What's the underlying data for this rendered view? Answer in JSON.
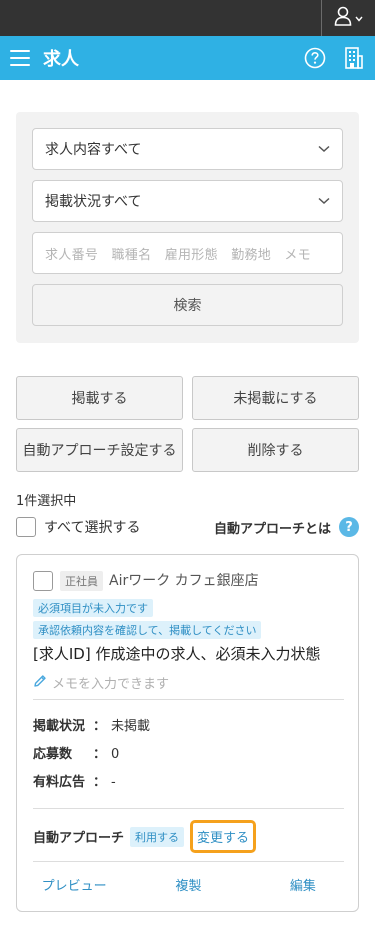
{
  "header": {
    "title": "求人"
  },
  "icons": {
    "account": "user-icon",
    "menu": "hamburger-icon",
    "help": "help-circle-icon",
    "building": "building-icon"
  },
  "filters": {
    "content_select": "求人内容すべて",
    "status_select": "掲載状況すべて",
    "keyword_placeholder": "求人番号　職種名　雇用形態　勤務地　メモ",
    "search_label": "検索"
  },
  "actions": {
    "publish": "掲載する",
    "unpublish": "未掲載にする",
    "auto_approach_setting": "自動アプローチ設定する",
    "delete": "削除する"
  },
  "selection": {
    "count_text": "1件選択中",
    "select_all": "すべて選択する",
    "auto_approach_link": "自動アプローチとは",
    "help_mark": "?"
  },
  "card": {
    "employment_tag": "正社員",
    "shop_name": "Airワーク カフェ銀座店",
    "notice_required": "必須項目が未入力です",
    "notice_approval": "承認依頼内容を確認して、掲載してください",
    "job_title": "[求人ID] 作成途中の求人、必須未入力状態",
    "memo_placeholder": "メモを入力できます",
    "rows": [
      {
        "key": "掲載状況",
        "colon": "：",
        "value": "未掲載"
      },
      {
        "key": "応募数",
        "colon": "：",
        "value": "0"
      },
      {
        "key": "有料広告",
        "colon": "：",
        "value": "-"
      }
    ],
    "auto_approach_label": "自動アプローチ",
    "auto_approach_status": "利用する",
    "change_label": "変更する",
    "links": {
      "preview": "プレビュー",
      "copy": "複製",
      "edit": "編集"
    }
  },
  "colors": {
    "brand": "#2fb1e4",
    "topbar": "#333333",
    "link": "#2f8fc4",
    "highlight": "#f5a11c"
  }
}
